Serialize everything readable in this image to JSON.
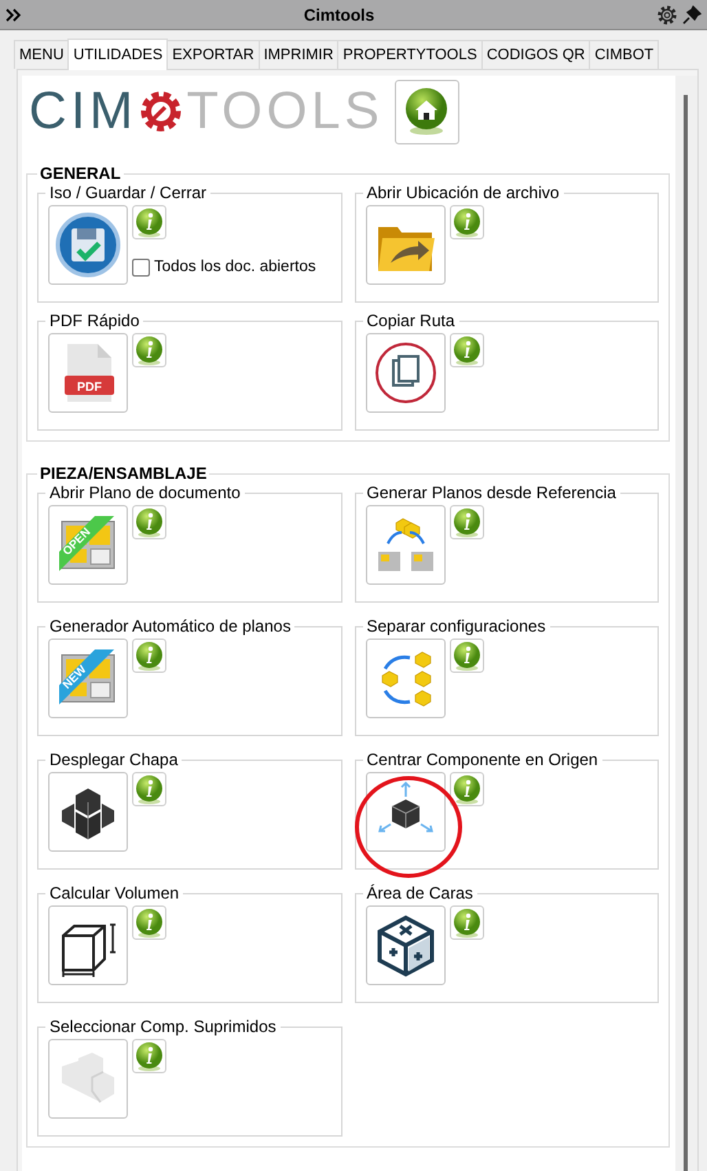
{
  "window": {
    "title": "Cimtools"
  },
  "tabs": [
    {
      "label": "MENU",
      "selected": false
    },
    {
      "label": "UTILIDADES",
      "selected": true
    },
    {
      "label": "EXPORTAR",
      "selected": false
    },
    {
      "label": "IMPRIMIR",
      "selected": false
    },
    {
      "label": "PROPERTYTOOLS",
      "selected": false
    },
    {
      "label": "CODIGOS QR",
      "selected": false
    },
    {
      "label": "CIMBOT",
      "selected": false
    }
  ],
  "logo": {
    "left": "CIM",
    "right": "TOOLS"
  },
  "sections": [
    {
      "title": "GENERAL",
      "tools": [
        {
          "title": "Iso / Guardar / Cerrar",
          "highlighted": false,
          "checkbox": {
            "label": "Todos los doc. abiertos",
            "checked": false
          }
        },
        {
          "title": "Abrir Ubicación de archivo",
          "highlighted": false
        },
        {
          "title": "PDF Rápido",
          "highlighted": false,
          "icon_text": "PDF"
        },
        {
          "title": "Copiar Ruta",
          "highlighted": false
        }
      ]
    },
    {
      "title": "PIEZA/ENSAMBLAJE",
      "tools": [
        {
          "title": "Abrir Plano de documento",
          "highlighted": false,
          "icon_text": "OPEN"
        },
        {
          "title": "Generar Planos desde Referencia",
          "highlighted": false
        },
        {
          "title": "Generador Automático de planos",
          "highlighted": false,
          "icon_text": "NEW"
        },
        {
          "title": "Separar configuraciones",
          "highlighted": false
        },
        {
          "title": "Desplegar Chapa",
          "highlighted": false
        },
        {
          "title": "Centrar Componente en Origen",
          "highlighted": true
        },
        {
          "title": "Calcular Volumen",
          "highlighted": false
        },
        {
          "title": "Área de Caras",
          "highlighted": false
        },
        {
          "title": "Seleccionar Comp. Suprimidos",
          "highlighted": false
        }
      ]
    }
  ]
}
